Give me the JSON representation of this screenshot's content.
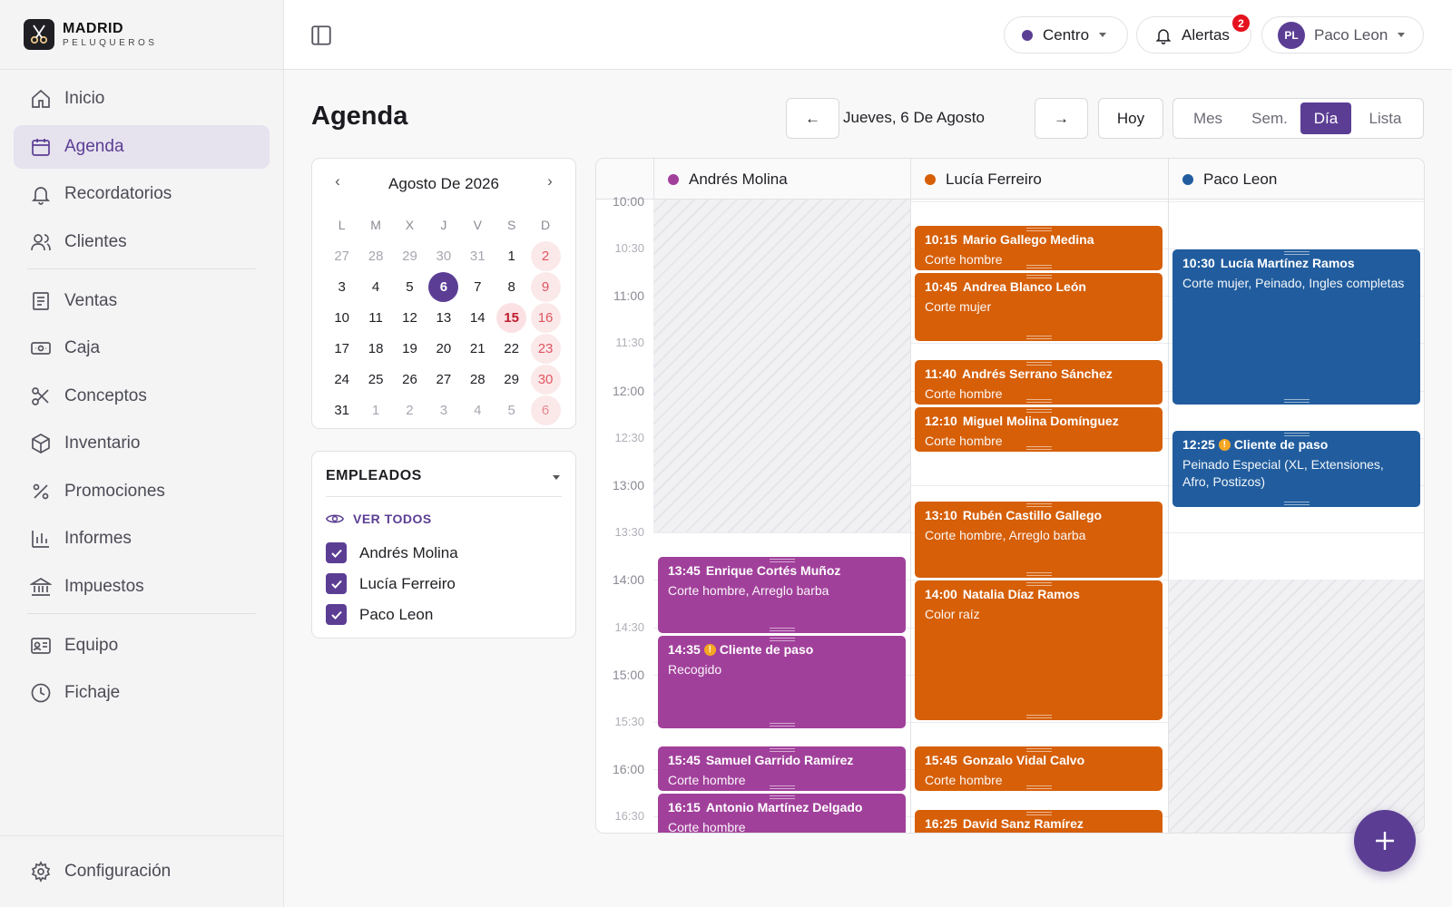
{
  "brand": {
    "name": "MADRID",
    "sub": "PELUQUEROS"
  },
  "sidebar": {
    "items": [
      {
        "label": "Inicio",
        "icon": "home-icon"
      },
      {
        "label": "Agenda",
        "icon": "calendar-icon",
        "active": true
      },
      {
        "label": "Recordatorios",
        "icon": "bell-icon"
      },
      {
        "label": "Clientes",
        "icon": "users-icon"
      },
      {
        "label": "Ventas",
        "icon": "receipt-icon"
      },
      {
        "label": "Caja",
        "icon": "cash-icon"
      },
      {
        "label": "Conceptos",
        "icon": "scissors-icon"
      },
      {
        "label": "Inventario",
        "icon": "box-icon"
      },
      {
        "label": "Promociones",
        "icon": "percent-icon"
      },
      {
        "label": "Informes",
        "icon": "bar-chart-icon"
      },
      {
        "label": "Impuestos",
        "icon": "bank-icon"
      },
      {
        "label": "Equipo",
        "icon": "id-card-icon"
      },
      {
        "label": "Fichaje",
        "icon": "clock-icon"
      }
    ],
    "settings_label": "Configuración"
  },
  "topbar": {
    "location": "Centro",
    "alerts_label": "Alertas",
    "alerts_count": "2",
    "user_initials": "PL",
    "user_name": "Paco Leon"
  },
  "header": {
    "title": "Agenda",
    "prev_label": "←",
    "date_label": "Jueves, 6 De Agosto",
    "next_label": "→",
    "today_label": "Hoy",
    "views": [
      "Mes",
      "Sem.",
      "Día",
      "Lista"
    ],
    "active_view": "Día"
  },
  "mini_calendar": {
    "title": "Agosto De 2026",
    "prev": "‹",
    "next": "›",
    "weekdays": [
      "L",
      "M",
      "X",
      "J",
      "V",
      "S",
      "D"
    ],
    "weeks": [
      [
        "27",
        "28",
        "29",
        "30",
        "31",
        "1",
        "2"
      ],
      [
        "3",
        "4",
        "5",
        "6",
        "7",
        "8",
        "9"
      ],
      [
        "10",
        "11",
        "12",
        "13",
        "14",
        "15",
        "16"
      ],
      [
        "17",
        "18",
        "19",
        "20",
        "21",
        "22",
        "23"
      ],
      [
        "24",
        "25",
        "26",
        "27",
        "28",
        "29",
        "30"
      ],
      [
        "31",
        "1",
        "2",
        "3",
        "4",
        "5",
        "6"
      ]
    ],
    "today": "6",
    "holiday": "15"
  },
  "employees": {
    "title": "EMPLEADOS",
    "view_all": "VER TODOS",
    "list": [
      {
        "name": "Andrés Molina",
        "checked": true
      },
      {
        "name": "Lucía Ferreiro",
        "checked": true
      },
      {
        "name": "Paco Leon",
        "checked": true
      }
    ]
  },
  "schedule": {
    "columns": [
      {
        "name": "Andrés Molina",
        "color": "#a1409b"
      },
      {
        "name": "Lucía Ferreiro",
        "color": "#d65f08"
      },
      {
        "name": "Paco Leon",
        "color": "#215d9e"
      }
    ],
    "times": [
      "10:00",
      "10:30",
      "11:00",
      "11:30",
      "12:00",
      "12:30",
      "13:00",
      "13:30",
      "14:00",
      "14:30",
      "15:00",
      "15:30",
      "16:00",
      "16:30"
    ],
    "appointments": [
      {
        "col": 0,
        "time": "13:45",
        "client": "Enrique Cortés Muñoz",
        "services": "Corte hombre, Arreglo barba",
        "walkin": false
      },
      {
        "col": 0,
        "time": "14:35",
        "client": "Cliente de paso",
        "services": "Recogido",
        "walkin": true
      },
      {
        "col": 0,
        "time": "15:45",
        "client": "Samuel Garrido Ramírez",
        "services": "Corte hombre",
        "walkin": false
      },
      {
        "col": 0,
        "time": "16:15",
        "client": "Antonio Martínez Delgado",
        "services": "Corte hombre",
        "walkin": false
      },
      {
        "col": 1,
        "time": "10:15",
        "client": "Mario Gallego Medina",
        "services": "Corte hombre",
        "walkin": false
      },
      {
        "col": 1,
        "time": "10:45",
        "client": "Andrea Blanco León",
        "services": "Corte mujer",
        "walkin": false
      },
      {
        "col": 1,
        "time": "11:40",
        "client": "Andrés Serrano Sánchez",
        "services": "Corte hombre",
        "walkin": false
      },
      {
        "col": 1,
        "time": "12:10",
        "client": "Miguel Molina Domínguez",
        "services": "Corte hombre",
        "walkin": false
      },
      {
        "col": 1,
        "time": "13:10",
        "client": "Rubén Castillo Gallego",
        "services": "Corte hombre, Arreglo barba",
        "walkin": false
      },
      {
        "col": 1,
        "time": "14:00",
        "client": "Natalia Díaz Ramos",
        "services": "Color raíz",
        "walkin": false
      },
      {
        "col": 1,
        "time": "15:45",
        "client": "Gonzalo Vidal Calvo",
        "services": "Corte hombre",
        "walkin": false
      },
      {
        "col": 1,
        "time": "16:25",
        "client": "David Sanz Ramírez",
        "services": "",
        "walkin": false
      },
      {
        "col": 2,
        "time": "10:30",
        "client": "Lucía Martínez Ramos",
        "services": "Corte mujer, Peinado, Ingles completas",
        "walkin": false
      },
      {
        "col": 2,
        "time": "12:25",
        "client": "Cliente de paso",
        "services": "Peinado Especial (XL, Extensiones, Afro, Postizos)",
        "walkin": true
      }
    ]
  },
  "colors": {
    "accent": "#5b3e94",
    "andres": "#a1409b",
    "lucia": "#d65f08",
    "paco": "#215d9e",
    "alert": "#e5121d",
    "warning": "#f5a623"
  }
}
